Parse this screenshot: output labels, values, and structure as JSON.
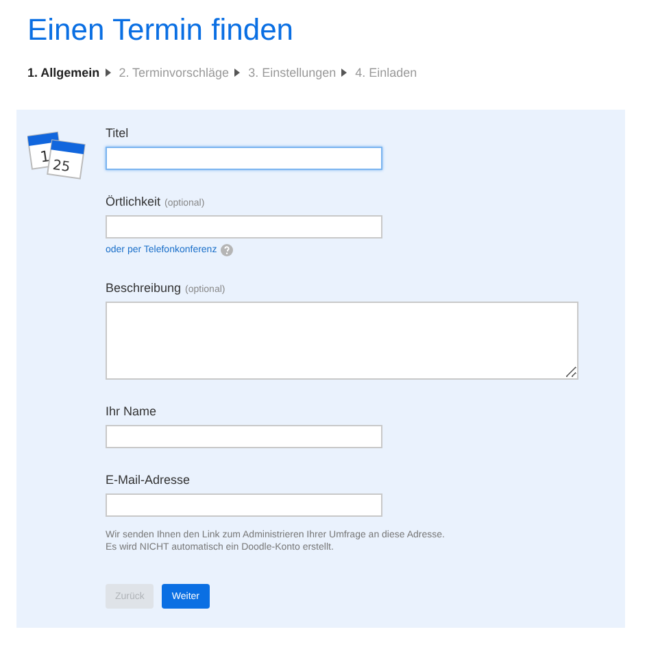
{
  "title": "Einen Termin finden",
  "steps": [
    {
      "label": "1. Allgemein",
      "selected": true
    },
    {
      "label": "2. Terminvorschläge",
      "selected": false
    },
    {
      "label": "3. Einstellungen",
      "selected": false
    },
    {
      "label": "4. Einladen",
      "selected": false
    }
  ],
  "icon_calendar": {
    "day_back": "1",
    "day_front": "25"
  },
  "fields": [
    {
      "kind": "input",
      "label": "Titel",
      "focused": true
    },
    {
      "kind": "input",
      "label": "Örtlichkeit",
      "hint": "(optional)",
      "focused": false,
      "link": "oder per Telefonkonferenz"
    },
    {
      "kind": "textarea",
      "label": "Beschreibung",
      "hint": "(optional)",
      "focused": false
    },
    {
      "kind": "input",
      "label": "Ihr Name",
      "focused": false
    },
    {
      "kind": "input",
      "label": "E-Mail-Adresse",
      "focused": false,
      "note": "Wir senden Ihnen den Link zum Administrieren Ihrer Umfrage an diese Adresse. Es wird NICHT automatisch ein Doodle-Konto erstellt."
    }
  ],
  "buttons": [
    {
      "label": "Zurück",
      "disabled": true
    },
    {
      "label": "Weiter",
      "disabled": false
    }
  ]
}
